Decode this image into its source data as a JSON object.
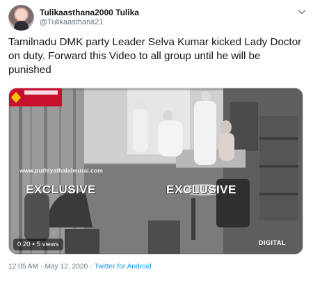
{
  "user": {
    "display_name": "Tulikaasthana2000 Tulika",
    "handle": "@Tulikaasthana21"
  },
  "tweet": {
    "text": "Tamilnadu DMK party Leader Selva Kumar kicked  Lady Doctor on duty. Forward this Video to all group until he will be punished"
  },
  "media": {
    "type": "video",
    "watermark_url": "www.puthiyathalaimurai.com",
    "overlay_left": "EXCLUSIVE",
    "overlay_right": "EXCLUSIVE",
    "logo_corner_text": "DIGITAL",
    "duration": "0:20",
    "views": "5 views",
    "overlay_accent": "#c8102e"
  },
  "meta": {
    "time": "12:05 AM",
    "date": "May 12, 2020",
    "source": "Twitter for Android",
    "separator": "·"
  },
  "icons": {
    "caret": "chevron-down-icon"
  }
}
